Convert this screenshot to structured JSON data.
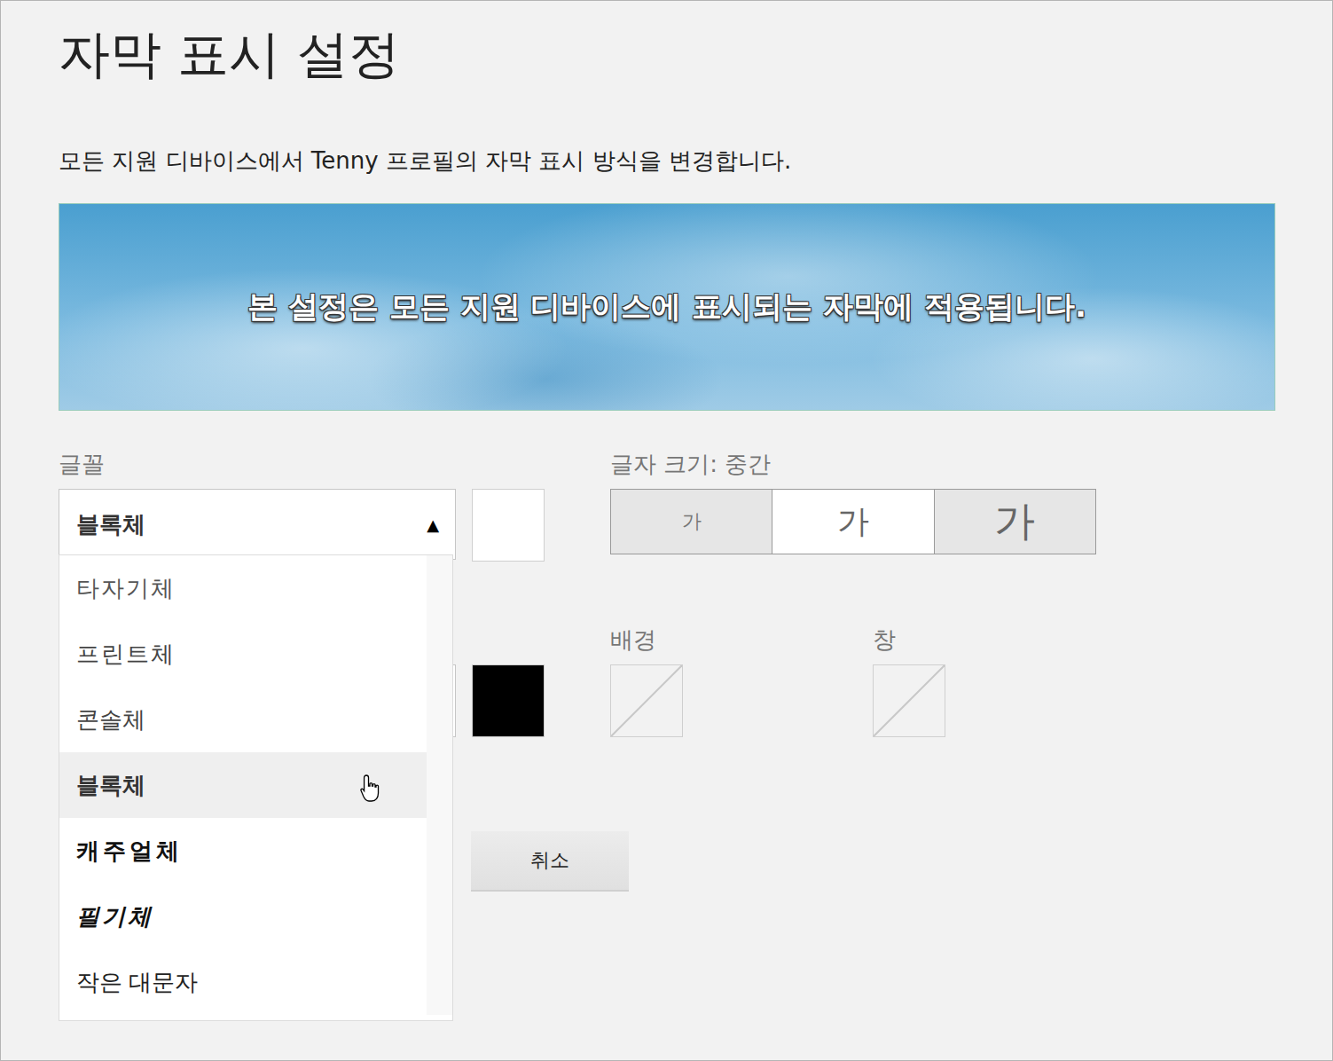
{
  "page": {
    "title": "자막 표시 설정",
    "description": "모든 지원 디바이스에서 Tenny 프로필의 자막 표시 방식을 변경합니다."
  },
  "preview": {
    "caption": "본 설정은 모든 지원 디바이스에 표시되는 자막에 적용됩니다."
  },
  "font": {
    "label": "글꼴",
    "value": "블록체",
    "arrow": "▲",
    "expanded": true,
    "color": "#ffffff",
    "options": [
      {
        "label": "타자기체",
        "kind": "typewriter",
        "selected": false
      },
      {
        "label": "프린트체",
        "kind": "print",
        "selected": false
      },
      {
        "label": "콘솔체",
        "kind": "console",
        "selected": false
      },
      {
        "label": "블록체",
        "kind": "block",
        "selected": true
      },
      {
        "label": "캐주얼체",
        "kind": "casual",
        "selected": false
      },
      {
        "label": "필기체",
        "kind": "script",
        "selected": false
      },
      {
        "label": "작은 대문자",
        "kind": "smallcaps",
        "selected": false
      }
    ]
  },
  "size": {
    "label": "글자 크기: 중간",
    "options": [
      {
        "label": "가",
        "selected": false
      },
      {
        "label": "가",
        "selected": true
      },
      {
        "label": "가",
        "selected": false
      }
    ]
  },
  "text_color": {
    "color": "#000000"
  },
  "background": {
    "label": "배경",
    "none": true
  },
  "window": {
    "label": "창",
    "none": true
  },
  "buttons": [
    {
      "label": "취소"
    }
  ]
}
